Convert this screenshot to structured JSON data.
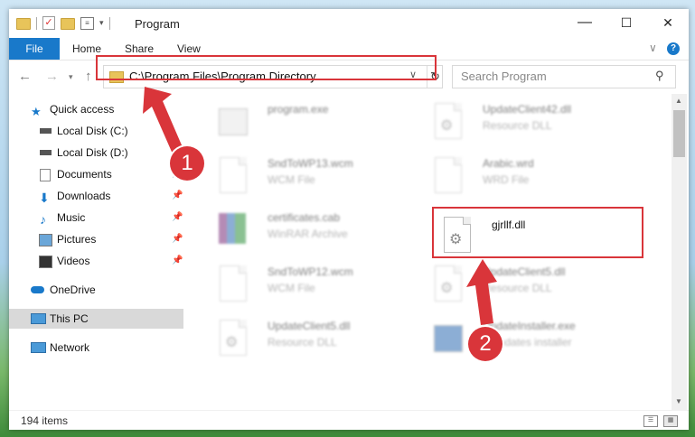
{
  "window": {
    "title": "Program",
    "controls": {
      "minimize": "—",
      "maximize": "☐",
      "close": "✕"
    }
  },
  "ribbon": {
    "tabs": [
      "File",
      "Home",
      "Share",
      "View"
    ],
    "help_chevron": "∨",
    "help_icon": "?"
  },
  "nav": {
    "back_icon": "arrow-left-icon",
    "forward_icon": "arrow-right-icon",
    "recent_icon": "chevron-down-icon",
    "up_icon": "arrow-up-icon",
    "address": "C:\\Program Files\\Program Directory",
    "search_placeholder": "Search Program"
  },
  "sidebar": {
    "items": [
      {
        "label": "Quick access",
        "icon": "star-icon"
      },
      {
        "label": "Local Disk (C:)",
        "icon": "drive-icon"
      },
      {
        "label": "Local Disk (D:)",
        "icon": "drive-icon"
      },
      {
        "label": "Documents",
        "icon": "documents-icon"
      },
      {
        "label": "Downloads",
        "icon": "download-icon"
      },
      {
        "label": "Music",
        "icon": "music-icon"
      },
      {
        "label": "Pictures",
        "icon": "pictures-icon"
      },
      {
        "label": "Videos",
        "icon": "videos-icon"
      },
      {
        "label": "OneDrive",
        "icon": "cloud-icon"
      },
      {
        "label": "This PC",
        "icon": "computer-icon",
        "selected": true
      },
      {
        "label": "Network",
        "icon": "network-icon"
      }
    ]
  },
  "files": [
    {
      "name": "program.exe",
      "type": "",
      "icon": "exe-icon"
    },
    {
      "name": "UpdateClient42.dll",
      "type": "Resource DLL",
      "icon": "dll-icon"
    },
    {
      "name": "SndToWP13.wcm",
      "type": "WCM File",
      "icon": "file-icon"
    },
    {
      "name": "Arabic.wrd",
      "type": "WRD File",
      "icon": "file-icon"
    },
    {
      "name": "certificates.cab",
      "type": "WinRAR Archive",
      "icon": "archive-icon"
    },
    {
      "name": "gjrllf.dll",
      "type": "",
      "icon": "dll-icon"
    },
    {
      "name": "SndToWP12.wcm",
      "type": "WCM File",
      "icon": "file-icon"
    },
    {
      "name": "UpdateClient5.dll",
      "type": "Resource DLL",
      "icon": "dll-icon"
    },
    {
      "name": "UpdateClient5.dll",
      "type": "Resource DLL",
      "icon": "dll-icon"
    },
    {
      "name": "UpdateInstaller.exe",
      "type": "Y updates installer",
      "icon": "exe-icon"
    }
  ],
  "status": {
    "item_count": "194 items"
  },
  "annotations": {
    "step1": "1",
    "step2": "2",
    "highlight_color": "#d9353a"
  },
  "colors": {
    "accent": "#1979ca",
    "selection": "#d9d9d9"
  }
}
